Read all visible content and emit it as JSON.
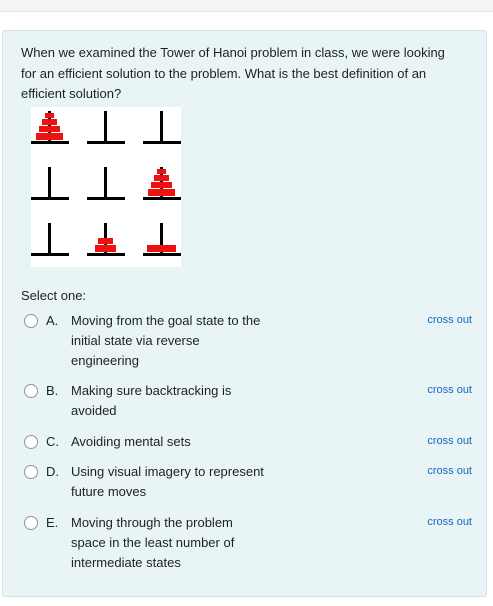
{
  "question": {
    "text": "When we examined the Tower of Hanoi problem in class, we were looking for an efficient solution to the problem. What is the best definition of an efficient solution?",
    "image_alt": "Tower of Hanoi states",
    "prompt": "Select one:"
  },
  "options": [
    {
      "letter": "A.",
      "text": "Moving from the goal state to the initial state via reverse engineering",
      "cross_out": "cross out"
    },
    {
      "letter": "B.",
      "text": "Making sure backtracking is avoided",
      "cross_out": "cross out"
    },
    {
      "letter": "C.",
      "text": "Avoiding mental sets",
      "cross_out": "cross out"
    },
    {
      "letter": "D.",
      "text": "Using visual imagery to represent future moves",
      "cross_out": "cross out"
    },
    {
      "letter": "E.",
      "text": "Moving through the problem space in the least number of intermediate states",
      "cross_out": "cross out"
    }
  ],
  "colors": {
    "accent_link": "#0f6cbf",
    "disk": "#ee1111",
    "question_bg": "#e9f4f6"
  }
}
